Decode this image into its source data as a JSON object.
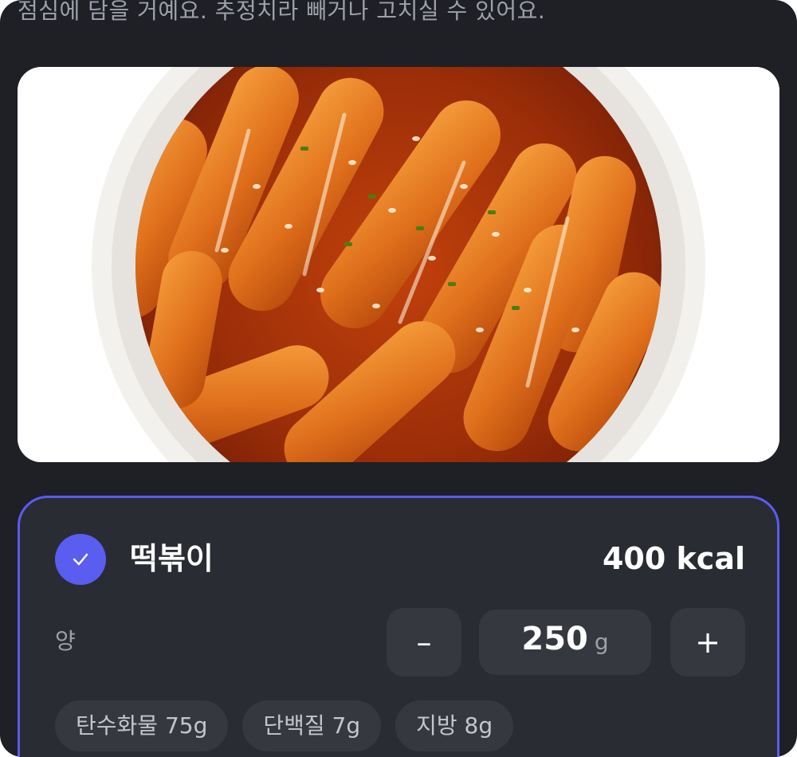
{
  "header": {
    "subtitle": "점심에 담을 거예요. 추정치라 빼거나 고치실 수 있어요."
  },
  "photo": {
    "alt": "떡볶이"
  },
  "food_card": {
    "selected": true,
    "check_icon": "checkmark-icon",
    "name": "떡볶이",
    "calories": "400 kcal",
    "quantity_label": "양",
    "decrement_label": "–",
    "increment_label": "+",
    "quantity_value": "250",
    "quantity_unit": "g",
    "nutrients": [
      {
        "label": "탄수화물 75g"
      },
      {
        "label": "단백질 7g"
      },
      {
        "label": "지방 8g"
      }
    ]
  },
  "colors": {
    "background": "#1e2026",
    "card": "#2a2c33",
    "accent": "#5b5cf0",
    "control": "#363840",
    "muted_text": "#9ea1ab"
  }
}
